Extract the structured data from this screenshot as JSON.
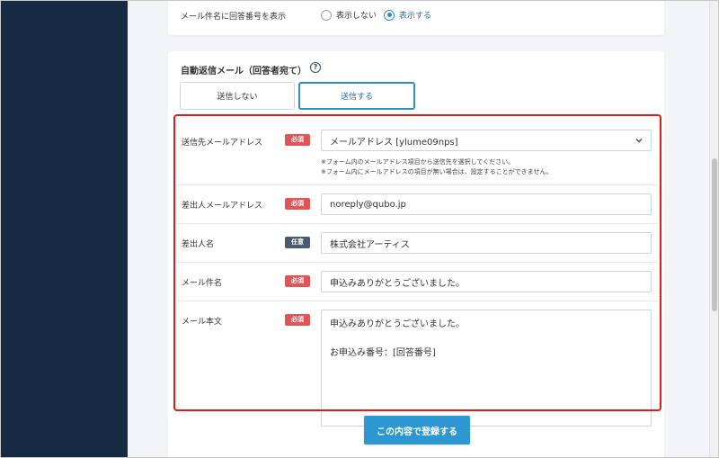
{
  "subject_number": {
    "label": "メール件名に回答番号を表示",
    "options": [
      "表示しない",
      "表示する"
    ],
    "selected": "表示する"
  },
  "auto_reply": {
    "title": "自動返信メール（回答者宛て）",
    "help_icon": "question-circle-icon",
    "tabs": [
      "送信しない",
      "送信する"
    ],
    "active_tab": "送信する"
  },
  "fields": {
    "to": {
      "label": "送信先メールアドレス",
      "badge": "必須",
      "value": "メールアドレス [ylume09nps]",
      "note1": "※フォーム内のメールアドレス項目から送信先を選択してください。",
      "note2": "※フォーム内にメールアドレスの項目が無い場合は、設定することができません。"
    },
    "from": {
      "label": "差出人メールアドレス",
      "badge": "必須",
      "value": "noreply@qubo.jp"
    },
    "sender_name": {
      "label": "差出人名",
      "badge": "任意",
      "value": "株式会社アーティス"
    },
    "subject": {
      "label": "メール件名",
      "badge": "必須",
      "value": "申込みありがとうございました。"
    },
    "body": {
      "label": "メール本文",
      "badge": "必須",
      "line1": "申込みありがとうございました。",
      "line2": "",
      "line3": "お申込み番号：[回答番号]"
    }
  },
  "submit_label": "この内容で登録する",
  "colors": {
    "accent": "#2d8bc9",
    "required": "#e05555",
    "optional": "#4a5b6e",
    "highlight": "#e0191b",
    "sidebar": "#172a43"
  }
}
